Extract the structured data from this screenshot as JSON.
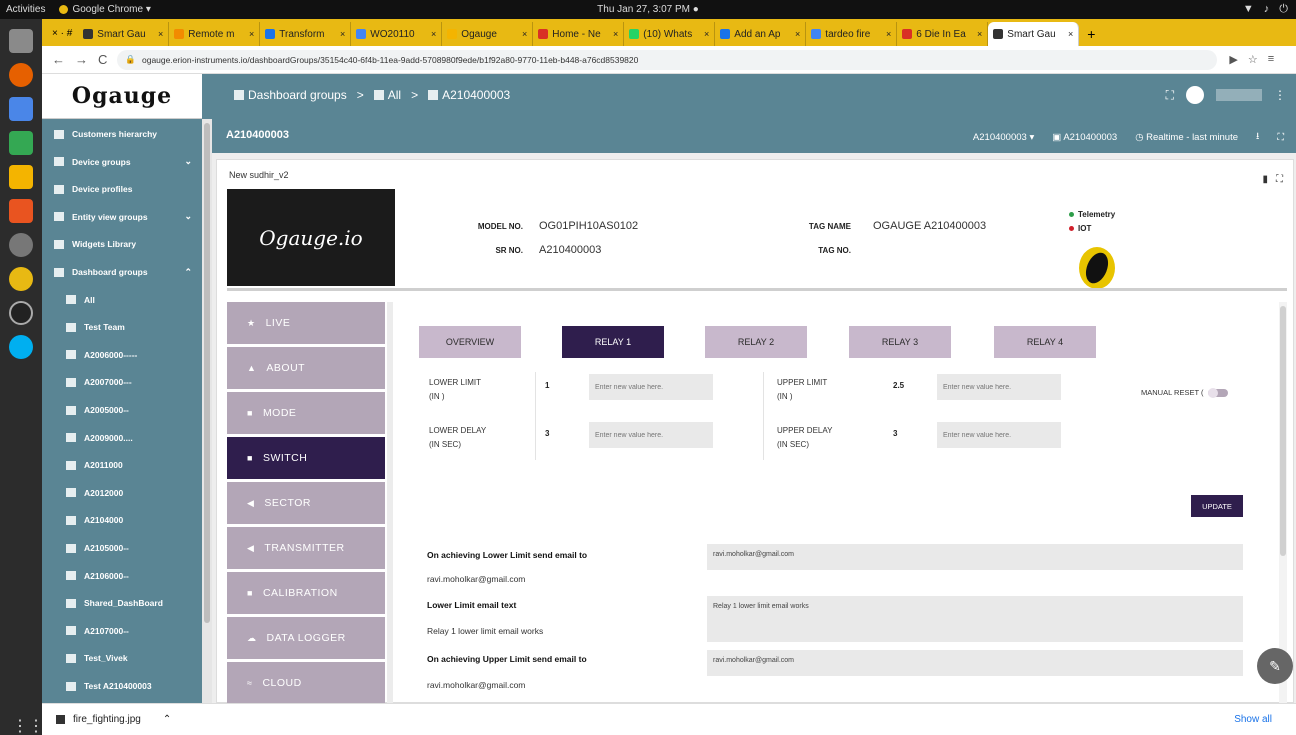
{
  "system": {
    "activities": "Activities",
    "app_name": "Google Chrome ▾",
    "clock": "Thu Jan 27, 3:07 PM ●"
  },
  "browser": {
    "tabs": [
      {
        "label": "Smart Gau",
        "color": "#333333"
      },
      {
        "label": "Remote m",
        "color": "#f28b00"
      },
      {
        "label": "Transform",
        "color": "#1a73e8"
      },
      {
        "label": "WO20110",
        "color": "#4285f4"
      },
      {
        "label": "Ogauge",
        "color": "#f4b400"
      },
      {
        "label": "Home - Ne",
        "color": "#d93025"
      },
      {
        "label": "(10) Whats",
        "color": "#25d366"
      },
      {
        "label": "Add an Ap",
        "color": "#1a73e8"
      },
      {
        "label": "tardeo fire",
        "color": "#4285f4"
      },
      {
        "label": "6 Die In Ea",
        "color": "#d93025"
      },
      {
        "label": "Smart Gau",
        "color": "#333333",
        "active": true
      }
    ],
    "new_tab": "+",
    "url": "ogauge.erion-instruments.io/dashboardGroups/35154c40-6f4b-11ea-9add-5708980f9ede/b1f92a80-9770-11eb-b448-a76cd8539820"
  },
  "header": {
    "logo": "Ogauge",
    "breadcrumbs": [
      "Dashboard groups",
      "All",
      "A210400003"
    ]
  },
  "sidebar": {
    "items": [
      {
        "label": "Customers hierarchy",
        "sub": false,
        "chevron": ""
      },
      {
        "label": "Device groups",
        "sub": false,
        "chevron": "⌄"
      },
      {
        "label": "Device profiles",
        "sub": false,
        "chevron": ""
      },
      {
        "label": "Entity view groups",
        "sub": false,
        "chevron": "⌄"
      },
      {
        "label": "Widgets Library",
        "sub": false,
        "chevron": ""
      },
      {
        "label": "Dashboard groups",
        "sub": false,
        "chevron": "⌃"
      },
      {
        "label": "All",
        "sub": true,
        "chevron": ""
      },
      {
        "label": "Test Team",
        "sub": true,
        "chevron": ""
      },
      {
        "label": "A2006000-----",
        "sub": true,
        "chevron": ""
      },
      {
        "label": "A2007000---",
        "sub": true,
        "chevron": ""
      },
      {
        "label": "A2005000--",
        "sub": true,
        "chevron": ""
      },
      {
        "label": "A2009000....",
        "sub": true,
        "chevron": ""
      },
      {
        "label": "A2011000",
        "sub": true,
        "chevron": ""
      },
      {
        "label": "A2012000",
        "sub": true,
        "chevron": ""
      },
      {
        "label": "A2104000",
        "sub": true,
        "chevron": ""
      },
      {
        "label": "A2105000--",
        "sub": true,
        "chevron": ""
      },
      {
        "label": "A2106000--",
        "sub": true,
        "chevron": ""
      },
      {
        "label": "Shared_DashBoard",
        "sub": true,
        "chevron": ""
      },
      {
        "label": "A2107000--",
        "sub": true,
        "chevron": ""
      },
      {
        "label": "Test_Vivek",
        "sub": true,
        "chevron": ""
      },
      {
        "label": "Test A210400003",
        "sub": true,
        "chevron": ""
      }
    ]
  },
  "dashboard": {
    "title": "A210400003",
    "state_select": "A210400003 ▾",
    "entity_label": "A210400003",
    "timewindow": "Realtime - last minute",
    "widget_title": "New sudhir_v2"
  },
  "device": {
    "logo_text": "Ogauge.io",
    "model_no_label": "MODEL NO.",
    "model_no": "OG01PIH10AS0102",
    "sr_no_label": "SR NO.",
    "sr_no": "A210400003",
    "tag_name_label": "TAG NAME",
    "tag_name": "OGAUGE A210400003",
    "tag_no_label": "TAG NO.",
    "tag_no": "",
    "legend": [
      {
        "label": "Telemetry",
        "color": "#2e9e4a"
      },
      {
        "label": "IOT",
        "color": "#d0202b"
      }
    ]
  },
  "menu": {
    "items": [
      {
        "label": "LIVE",
        "icon": "star-icon",
        "glyph": "★"
      },
      {
        "label": "ABOUT",
        "icon": "warning-icon",
        "glyph": "▲"
      },
      {
        "label": "MODE",
        "icon": "square-icon",
        "glyph": "■"
      },
      {
        "label": "SWITCH",
        "icon": "square-icon",
        "glyph": "■",
        "active": true
      },
      {
        "label": "SECTOR",
        "icon": "send-icon",
        "glyph": "◀"
      },
      {
        "label": "TRANSMITTER",
        "icon": "send-icon",
        "glyph": "◀"
      },
      {
        "label": "CALIBRATION",
        "icon": "square-icon",
        "glyph": "■"
      },
      {
        "label": "DATA LOGGER",
        "icon": "cloud-icon",
        "glyph": "☁"
      },
      {
        "label": "CLOUD",
        "icon": "wifi-icon",
        "glyph": "≈"
      }
    ]
  },
  "relay": {
    "tabs": [
      "OVERVIEW",
      "RELAY 1",
      "RELAY 2",
      "RELAY 3",
      "RELAY 4"
    ],
    "active_tab": "RELAY 1",
    "lower_limit_label_1": "LOWER LIMIT",
    "lower_limit_label_2": "(IN )",
    "lower_limit_value": "1",
    "upper_limit_label_1": "UPPER LIMIT",
    "upper_limit_label_2": "(IN )",
    "upper_limit_value": "2.5",
    "lower_delay_label_1": "LOWER DELAY",
    "lower_delay_label_2": "(IN SEC)",
    "lower_delay_value": "3",
    "upper_delay_label_1": "UPPER DELAY",
    "upper_delay_label_2": "(IN SEC)",
    "upper_delay_value": "3",
    "input_placeholder": "Enter new value here.",
    "manual_reset": "MANUAL RESET (",
    "update": "UPDATE",
    "lower_email_label": "On achieving Lower Limit send email to",
    "lower_email_current": "ravi.moholkar@gmail.com",
    "lower_email_input": "ravi.moholkar@gmail.com",
    "lower_text_label": "Lower Limit email text",
    "lower_text_current": "Relay 1 lower limit email works",
    "lower_text_input": "Relay 1 lower limit email works",
    "upper_email_label": "On achieving Upper Limit send email to",
    "upper_email_current": "ravi.moholkar@gmail.com",
    "upper_email_input": "ravi.moholkar@gmail.com"
  },
  "downloads": {
    "file": "fire_fighting.jpg",
    "show_all": "Show all"
  }
}
